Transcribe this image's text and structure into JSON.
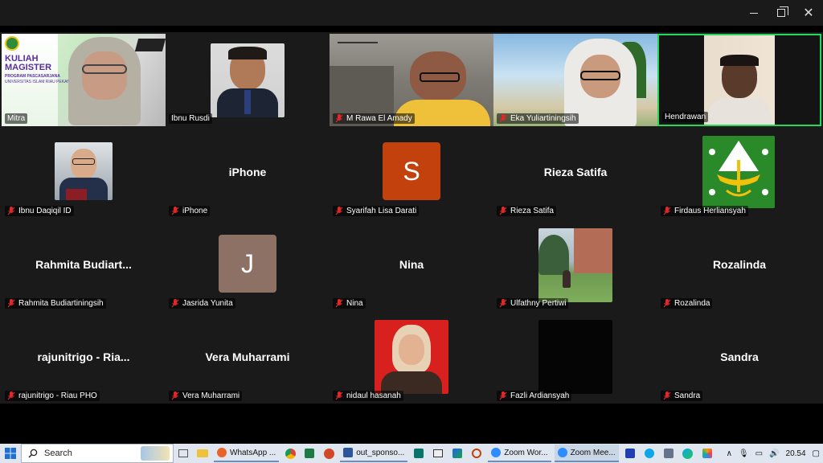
{
  "window": {
    "minimize_label": "",
    "maximize_label": "",
    "close_label": "✕"
  },
  "participants": [
    {
      "name": "Mitra",
      "type": "video",
      "muted": false,
      "overlay_lines": [
        "KULIAH",
        "MAGISTER",
        "PROGRAM PASCASARJANA",
        "UNIVERSITAS ISLAM RIAU PEKANBARU"
      ]
    },
    {
      "name": "Ibnu Rusdi",
      "type": "photo",
      "muted": false
    },
    {
      "name": "M Rawa El Amady",
      "type": "video",
      "muted": true
    },
    {
      "name": "Eka Yuliartiningsih",
      "type": "video",
      "muted": true
    },
    {
      "name": "Hendrawan",
      "type": "video",
      "muted": false,
      "active_speaker": true
    },
    {
      "name": "Ibnu Daqiqil ID",
      "type": "photo",
      "muted": true
    },
    {
      "name": "iPhone",
      "display": "iPhone",
      "type": "name",
      "muted": true
    },
    {
      "name": "Syarifah Lisa Darati",
      "type": "initial",
      "initial": "S",
      "muted": true
    },
    {
      "name": "Rieza Satifa",
      "display": "Rieza Satifa",
      "type": "name",
      "muted": true
    },
    {
      "name": "Firdaus Herliansyah",
      "type": "photo",
      "muted": true
    },
    {
      "name": "Rahmita Budiartiningsih",
      "display": "Rahmita  Budiart...",
      "type": "name",
      "muted": true
    },
    {
      "name": "Jasrida Yunita",
      "type": "initial",
      "initial": "J",
      "muted": true
    },
    {
      "name": "Nina",
      "display": "Nina",
      "type": "name",
      "muted": true
    },
    {
      "name": "Ulfathny Pertiwi",
      "type": "photo",
      "muted": true
    },
    {
      "name": "Rozalinda",
      "display": "Rozalinda",
      "type": "name",
      "muted": true
    },
    {
      "name": "rajunitrigo - Riau PHO",
      "display": "rajunitrigo  -  Ria...",
      "type": "name",
      "muted": true
    },
    {
      "name": "Vera Muharrami",
      "display": "Vera Muharrami",
      "type": "name",
      "muted": true
    },
    {
      "name": "nidaul hasanah",
      "type": "photo",
      "muted": true
    },
    {
      "name": "Fazli Ardiansyah",
      "type": "photo",
      "muted": true
    },
    {
      "name": "Sandra",
      "display": "Sandra",
      "type": "name",
      "muted": true
    }
  ],
  "colors": {
    "active_border": "#23d95d",
    "tile_bg": "#1a1a1a",
    "initial_s": "#c2410c",
    "initial_j": "#8d7165",
    "mic_muted": "#e02828"
  },
  "taskbar": {
    "search_label": "Search",
    "apps": [
      {
        "label": "WhatsApp ...",
        "icon": "firefox-icon"
      },
      {
        "label": "out_sponso...",
        "icon": "word-icon"
      },
      {
        "label": "Zoom Wor...",
        "icon": "zoom-icon"
      },
      {
        "label": "Zoom Mee...",
        "icon": "zoom-icon"
      }
    ],
    "time": "20.54"
  }
}
